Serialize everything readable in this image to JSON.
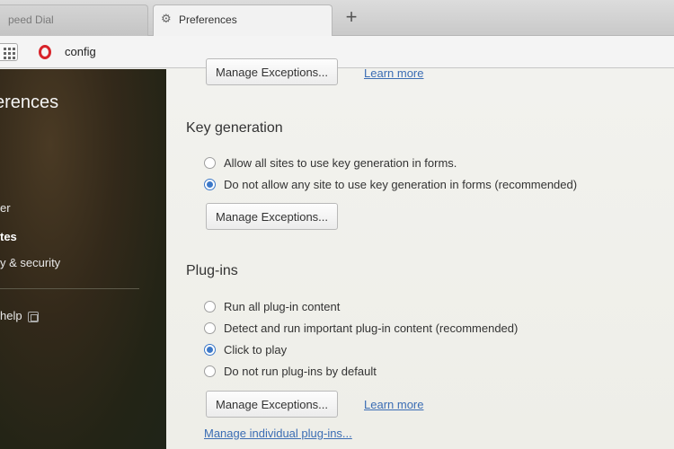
{
  "tabs": [
    {
      "label": "peed Dial",
      "active": false
    },
    {
      "label": "Preferences",
      "active": true
    }
  ],
  "newtab_label": "+",
  "address": {
    "value": "config"
  },
  "sidebar": {
    "title": "erences",
    "items": [
      {
        "label": "er",
        "active": false
      },
      {
        "label": "tes",
        "active": true
      },
      {
        "label": "y & security",
        "active": false
      }
    ],
    "help_label": " help"
  },
  "main": {
    "top_button": "Manage Exceptions...",
    "top_link": "Learn more",
    "keygen": {
      "title": "Key generation",
      "options": [
        {
          "label": "Allow all sites to use key generation in forms.",
          "checked": false
        },
        {
          "label": "Do not allow any site to use key generation in forms (recommended)",
          "checked": true
        }
      ],
      "button": "Manage Exceptions..."
    },
    "plugins": {
      "title": "Plug-ins",
      "options": [
        {
          "label": "Run all plug-in content",
          "checked": false
        },
        {
          "label": "Detect and run important plug-in content (recommended)",
          "checked": false
        },
        {
          "label": "Click to play",
          "checked": true
        },
        {
          "label": "Do not run plug-ins by default",
          "checked": false
        }
      ],
      "button": "Manage Exceptions...",
      "learn_more": "Learn more",
      "manage_individual": "Manage individual plug-ins..."
    }
  },
  "colors": {
    "accent": "#3c78c8",
    "link": "#3b6db4",
    "opera_red": "#d8232a"
  }
}
